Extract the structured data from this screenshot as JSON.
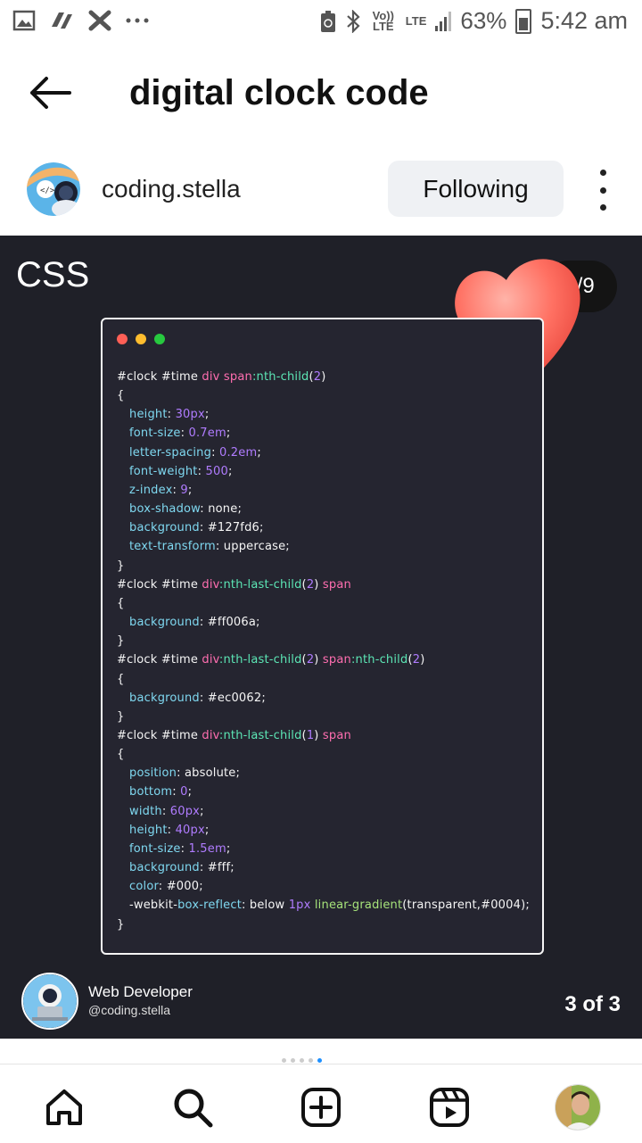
{
  "status_bar": {
    "battery": "63%",
    "time": "5:42 am",
    "volte": "Vo)) LTE",
    "lte": "LTE"
  },
  "header": {
    "title": "digital clock code"
  },
  "profile": {
    "username": "coding.stella",
    "follow_label": "Following"
  },
  "post": {
    "heading": "CSS",
    "page_counter": "6/9",
    "code_lines": [
      [
        [
          "sel",
          "#clock #time "
        ],
        [
          "tag",
          "div span"
        ],
        [
          "pseudo",
          ":nth-child"
        ],
        [
          "sel",
          "("
        ],
        [
          "num",
          "2"
        ],
        [
          "sel",
          ")"
        ]
      ],
      [
        [
          "sel",
          "{"
        ]
      ],
      [
        [
          "prop",
          "height"
        ],
        [
          "val",
          ": "
        ],
        [
          "num",
          "30px"
        ],
        [
          "val",
          ";"
        ]
      ],
      [
        [
          "prop",
          "font-size"
        ],
        [
          "val",
          ": "
        ],
        [
          "num",
          "0.7em"
        ],
        [
          "val",
          ";"
        ]
      ],
      [
        [
          "prop",
          "letter-spacing"
        ],
        [
          "val",
          ": "
        ],
        [
          "num",
          "0.2em"
        ],
        [
          "val",
          ";"
        ]
      ],
      [
        [
          "prop",
          "font-weight"
        ],
        [
          "val",
          ": "
        ],
        [
          "num",
          "500"
        ],
        [
          "val",
          ";"
        ]
      ],
      [
        [
          "prop",
          "z-index"
        ],
        [
          "val",
          ": "
        ],
        [
          "num",
          "9"
        ],
        [
          "val",
          ";"
        ]
      ],
      [
        [
          "prop",
          "box-shadow"
        ],
        [
          "val",
          ": none;"
        ]
      ],
      [
        [
          "prop",
          "background"
        ],
        [
          "val",
          ": #127fd6;"
        ]
      ],
      [
        [
          "prop",
          "text-transform"
        ],
        [
          "val",
          ": uppercase;"
        ]
      ],
      [
        [
          "sel",
          "}"
        ]
      ],
      [
        [
          "sel",
          "#clock #time "
        ],
        [
          "tag",
          "div"
        ],
        [
          "pseudo",
          ":nth-last-child"
        ],
        [
          "sel",
          "("
        ],
        [
          "num",
          "2"
        ],
        [
          "sel",
          ") "
        ],
        [
          "tag",
          "span"
        ]
      ],
      [
        [
          "sel",
          "{"
        ]
      ],
      [
        [
          "prop",
          "background"
        ],
        [
          "val",
          ": #ff006a;"
        ]
      ],
      [
        [
          "sel",
          "}"
        ]
      ],
      [
        [
          "sel",
          "#clock #time "
        ],
        [
          "tag",
          "div"
        ],
        [
          "pseudo",
          ":nth-last-child"
        ],
        [
          "sel",
          "("
        ],
        [
          "num",
          "2"
        ],
        [
          "sel",
          ") "
        ],
        [
          "tag",
          "span"
        ],
        [
          "pseudo",
          ":nth-child"
        ],
        [
          "sel",
          "("
        ],
        [
          "num",
          "2"
        ],
        [
          "sel",
          ")"
        ]
      ],
      [
        [
          "sel",
          "{"
        ]
      ],
      [
        [
          "prop",
          "background"
        ],
        [
          "val",
          ": #ec0062;"
        ]
      ],
      [
        [
          "sel",
          "}"
        ]
      ],
      [
        [
          "sel",
          "#clock #time "
        ],
        [
          "tag",
          "div"
        ],
        [
          "pseudo",
          ":nth-last-child"
        ],
        [
          "sel",
          "("
        ],
        [
          "num",
          "1"
        ],
        [
          "sel",
          ") "
        ],
        [
          "tag",
          "span"
        ]
      ],
      [
        [
          "sel",
          "{"
        ]
      ],
      [
        [
          "prop",
          "position"
        ],
        [
          "val",
          ": absolute;"
        ]
      ],
      [
        [
          "prop",
          "bottom"
        ],
        [
          "val",
          ": "
        ],
        [
          "num",
          "0"
        ],
        [
          "val",
          ";"
        ]
      ],
      [
        [
          "prop",
          "width"
        ],
        [
          "val",
          ": "
        ],
        [
          "num",
          "60px"
        ],
        [
          "val",
          ";"
        ]
      ],
      [
        [
          "prop",
          "height"
        ],
        [
          "val",
          ": "
        ],
        [
          "num",
          "40px"
        ],
        [
          "val",
          ";"
        ]
      ],
      [
        [
          "prop",
          "font-size"
        ],
        [
          "val",
          ": "
        ],
        [
          "num",
          "1.5em"
        ],
        [
          "val",
          ";"
        ]
      ],
      [
        [
          "prop",
          "background"
        ],
        [
          "val",
          ": #fff;"
        ]
      ],
      [
        [
          "prop",
          "color"
        ],
        [
          "val",
          ": #000;"
        ]
      ],
      [
        [
          "val",
          "-webkit-"
        ],
        [
          "prop",
          "box-reflect"
        ],
        [
          "val",
          ": below "
        ],
        [
          "num",
          "1px"
        ],
        [
          "val",
          " "
        ],
        [
          "fn",
          "linear-gradient"
        ],
        [
          "val",
          "(transparent,#0004);"
        ]
      ],
      [
        [
          "sel",
          "}"
        ]
      ]
    ],
    "indented_lines": [
      2,
      3,
      4,
      5,
      6,
      7,
      8,
      9,
      13,
      17,
      21,
      22,
      23,
      24,
      25,
      26,
      27,
      28
    ],
    "author_title": "Web Developer",
    "author_handle": "@coding.stella",
    "slide_indicator": "3 of 3"
  },
  "colors": {
    "post_bg": "#1f2028",
    "window_red": "#ff5f56",
    "window_yellow": "#ffbd2e",
    "window_green": "#27c93f",
    "accent_blue": "#1e90ff"
  },
  "icons": [
    "gallery-icon",
    "app-icon",
    "tools-icon",
    "more-notifications-icon",
    "recycle-icon",
    "bluetooth-icon",
    "signal-icon",
    "battery-icon",
    "back-arrow-icon",
    "more-vertical-icon",
    "heart-icon",
    "home-icon",
    "search-icon",
    "create-icon",
    "reels-icon"
  ]
}
